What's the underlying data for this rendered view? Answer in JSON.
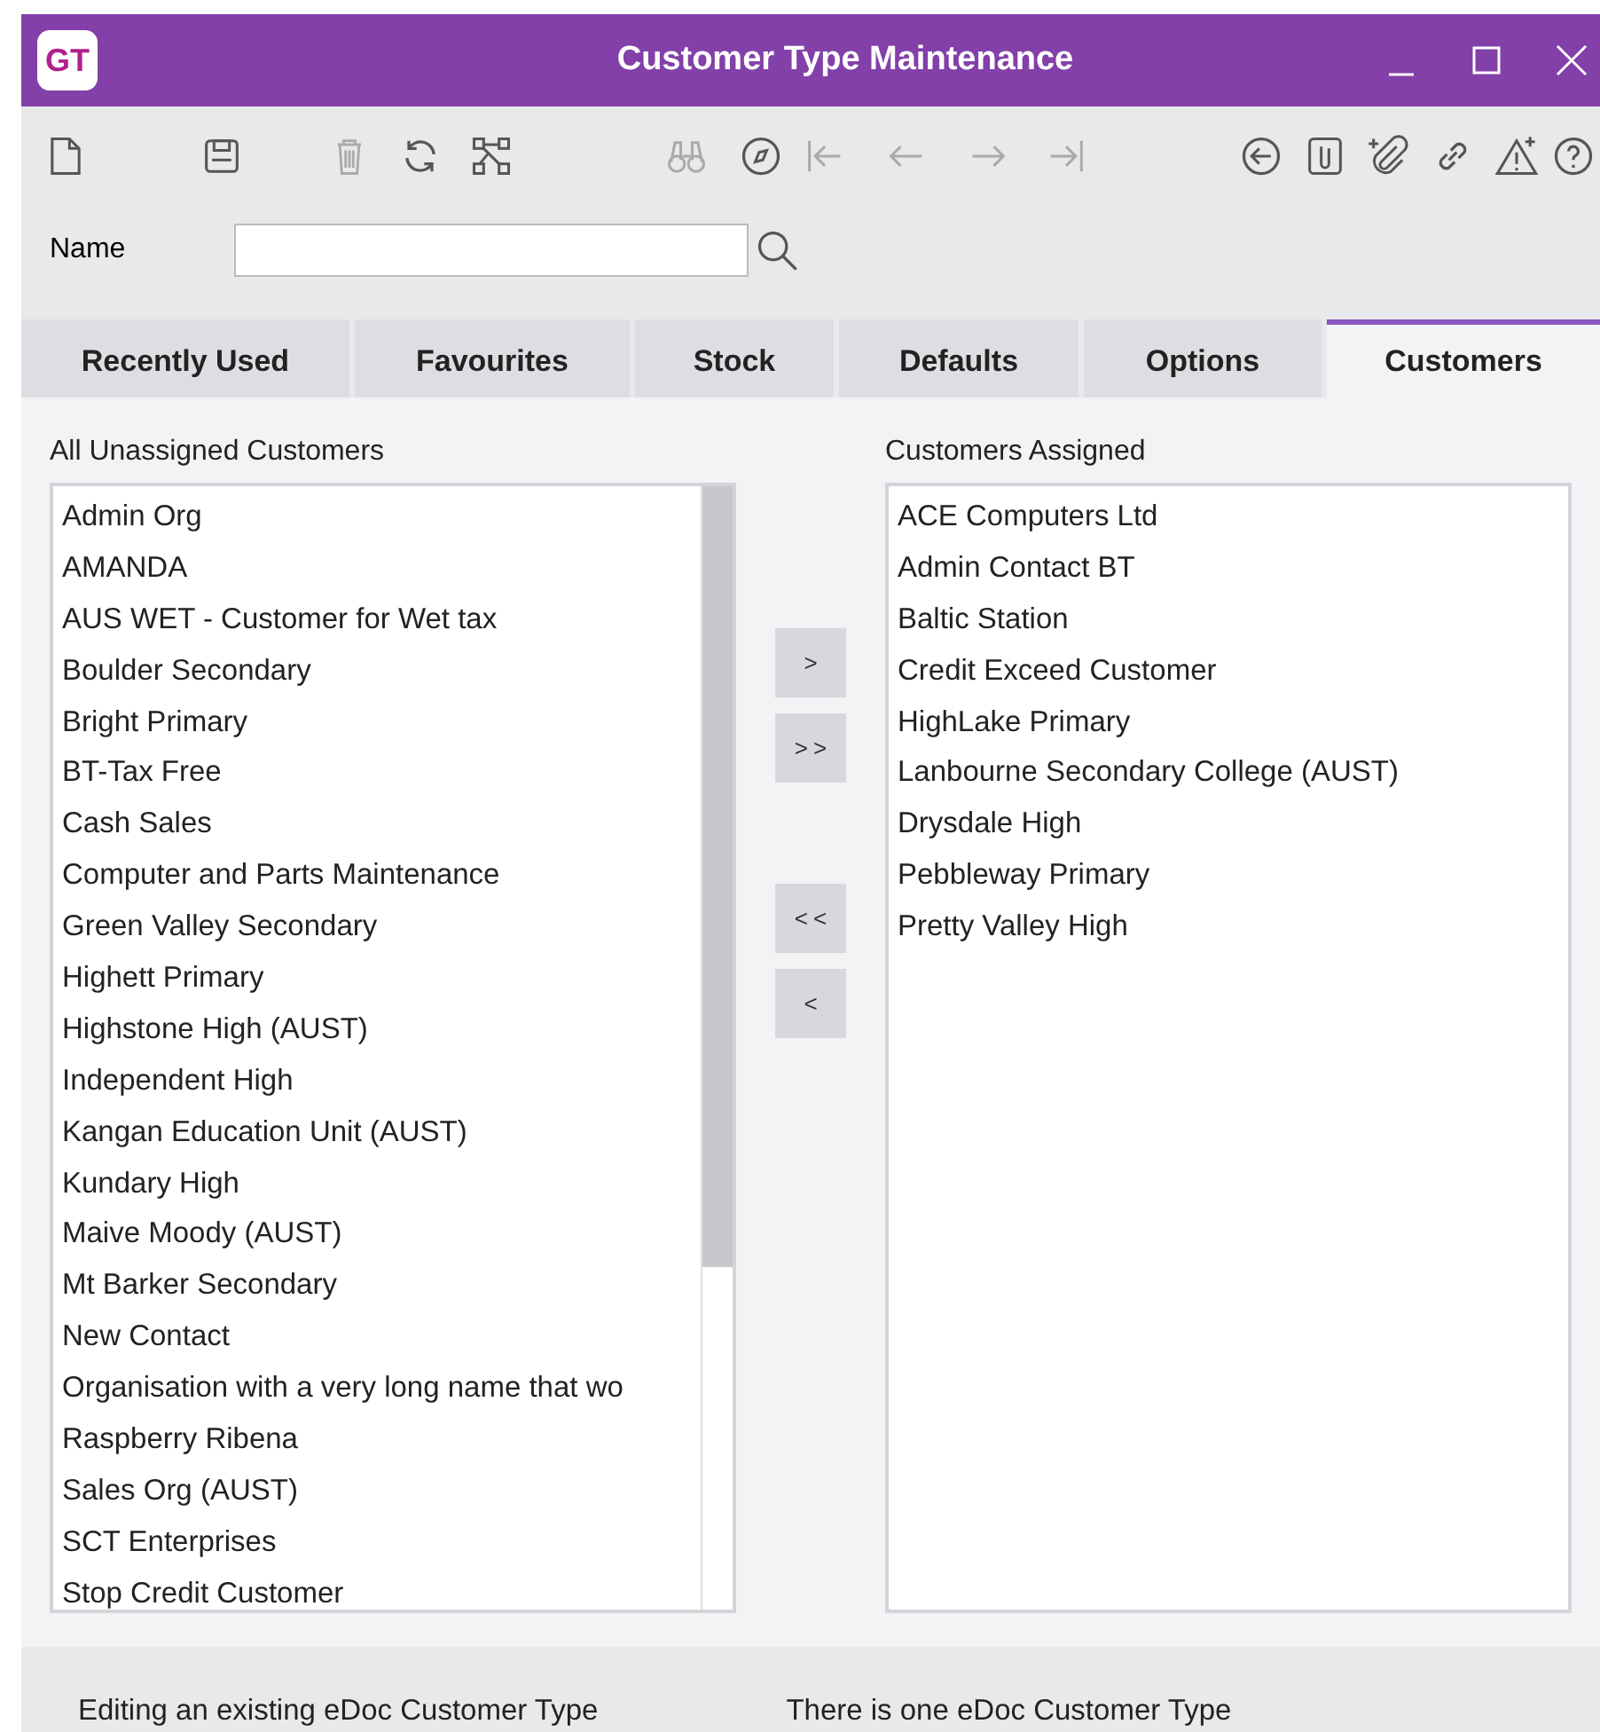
{
  "window": {
    "logo": "GT",
    "title": "Customer Type Maintenance"
  },
  "name_field": {
    "label": "Name"
  },
  "tabs": [
    {
      "label": "Recently Used",
      "selected": false
    },
    {
      "label": "Favourites",
      "selected": false
    },
    {
      "label": "Stock",
      "selected": false
    },
    {
      "label": "Defaults",
      "selected": false
    },
    {
      "label": "Options",
      "selected": false
    },
    {
      "label": "Customers",
      "selected": true
    }
  ],
  "unassigned": {
    "title": "All Unassigned Customers",
    "items": [
      "Admin Org",
      "AMANDA",
      "AUS WET - Customer for Wet tax",
      "Boulder Secondary",
      "Bright Primary",
      "BT-Tax Free",
      "Cash Sales",
      "Computer and Parts Maintenance",
      "Green Valley Secondary",
      "Highett Primary",
      "Highstone High (AUST)",
      "Independent High",
      "Kangan Education Unit (AUST)",
      "Kundary High",
      "Maive Moody (AUST)",
      "Mt Barker Secondary",
      "New Contact",
      "Organisation with a very long name that wo",
      "Raspberry Ribena",
      "Sales Org (AUST)",
      "SCT Enterprises",
      "Stop Credit Customer"
    ]
  },
  "move_buttons": [
    ">",
    ">>",
    "<<",
    "<"
  ],
  "assigned": {
    "title": "Customers Assigned",
    "items": [
      "ACE Computers Ltd",
      "Admin Contact BT",
      "Baltic Station",
      "Credit Exceed Customer",
      "HighLake Primary",
      "Lanbourne Secondary College (AUST)",
      "Drysdale High",
      "Pebbleway Primary",
      "Pretty Valley High"
    ]
  },
  "status_bar": [
    "Editing an existing eDoc Customer Type",
    "There is one eDoc Customer Type"
  ]
}
